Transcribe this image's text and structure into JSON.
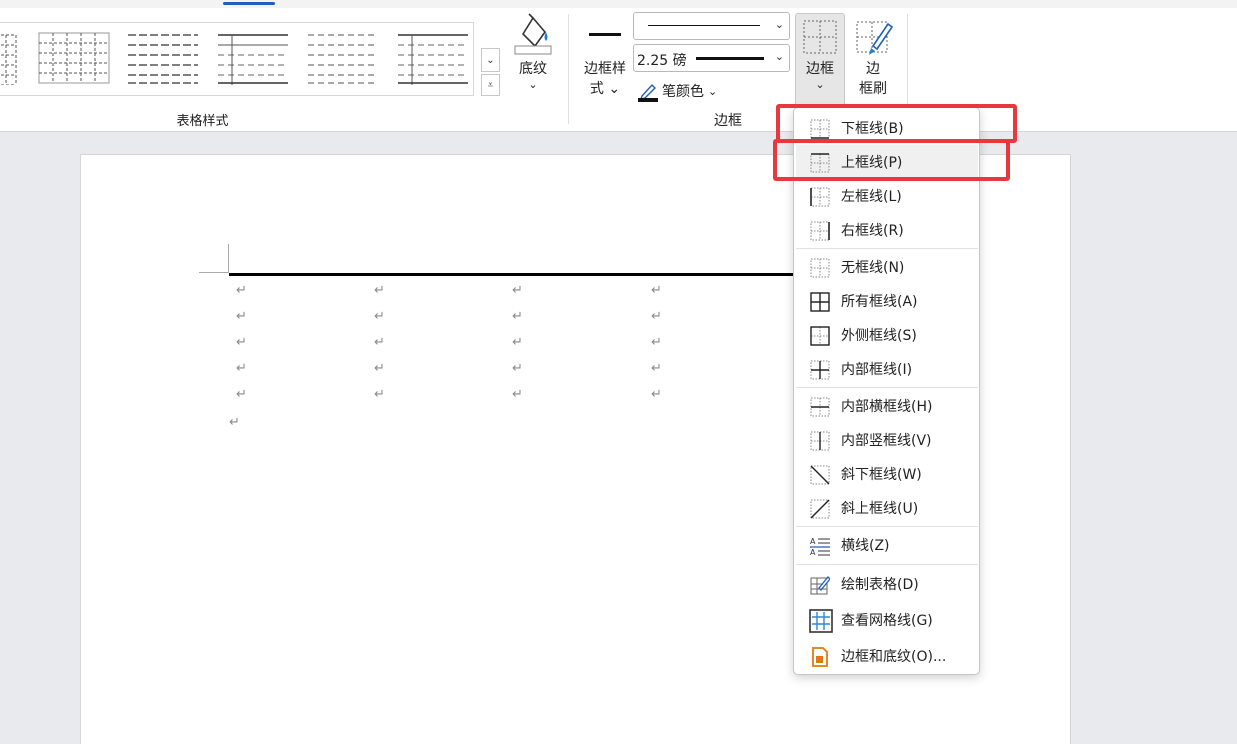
{
  "ribbon": {
    "table_styles_group": "表格样式",
    "shading": "底纹",
    "border_styles": [
      "边框样",
      "式"
    ],
    "line_weight": "2.25 磅",
    "pen_color": "笔颜色",
    "borders_group": "边框",
    "borders_button": "边框",
    "border_painter": [
      "边",
      "框刷"
    ]
  },
  "document": {
    "paragraph_mark": "↵"
  },
  "borders_menu": {
    "items": [
      {
        "label": "下框线(B)",
        "icon": "bottom-border-icon"
      },
      {
        "label": "上框线(P)",
        "icon": "top-border-icon"
      },
      {
        "label": "左框线(L)",
        "icon": "left-border-icon"
      },
      {
        "label": "右框线(R)",
        "icon": "right-border-icon"
      },
      {
        "label": "无框线(N)",
        "icon": "no-border-icon"
      },
      {
        "label": "所有框线(A)",
        "icon": "all-borders-icon"
      },
      {
        "label": "外侧框线(S)",
        "icon": "outside-borders-icon"
      },
      {
        "label": "内部框线(I)",
        "icon": "inside-borders-icon"
      },
      {
        "label": "内部横框线(H)",
        "icon": "inside-horizontal-border-icon"
      },
      {
        "label": "内部竖框线(V)",
        "icon": "inside-vertical-border-icon"
      },
      {
        "label": "斜下框线(W)",
        "icon": "diagonal-down-border-icon"
      },
      {
        "label": "斜上框线(U)",
        "icon": "diagonal-up-border-icon"
      },
      {
        "label": "横线(Z)",
        "icon": "horizontal-line-icon"
      },
      {
        "label": "绘制表格(D)",
        "icon": "draw-table-icon"
      },
      {
        "label": "查看网格线(G)",
        "icon": "view-gridlines-icon"
      },
      {
        "label": "边框和底纹(O)...",
        "icon": "borders-and-shading-icon"
      }
    ]
  },
  "colors": {
    "highlight": "#e8383d",
    "accent": "#1f5fbf"
  }
}
